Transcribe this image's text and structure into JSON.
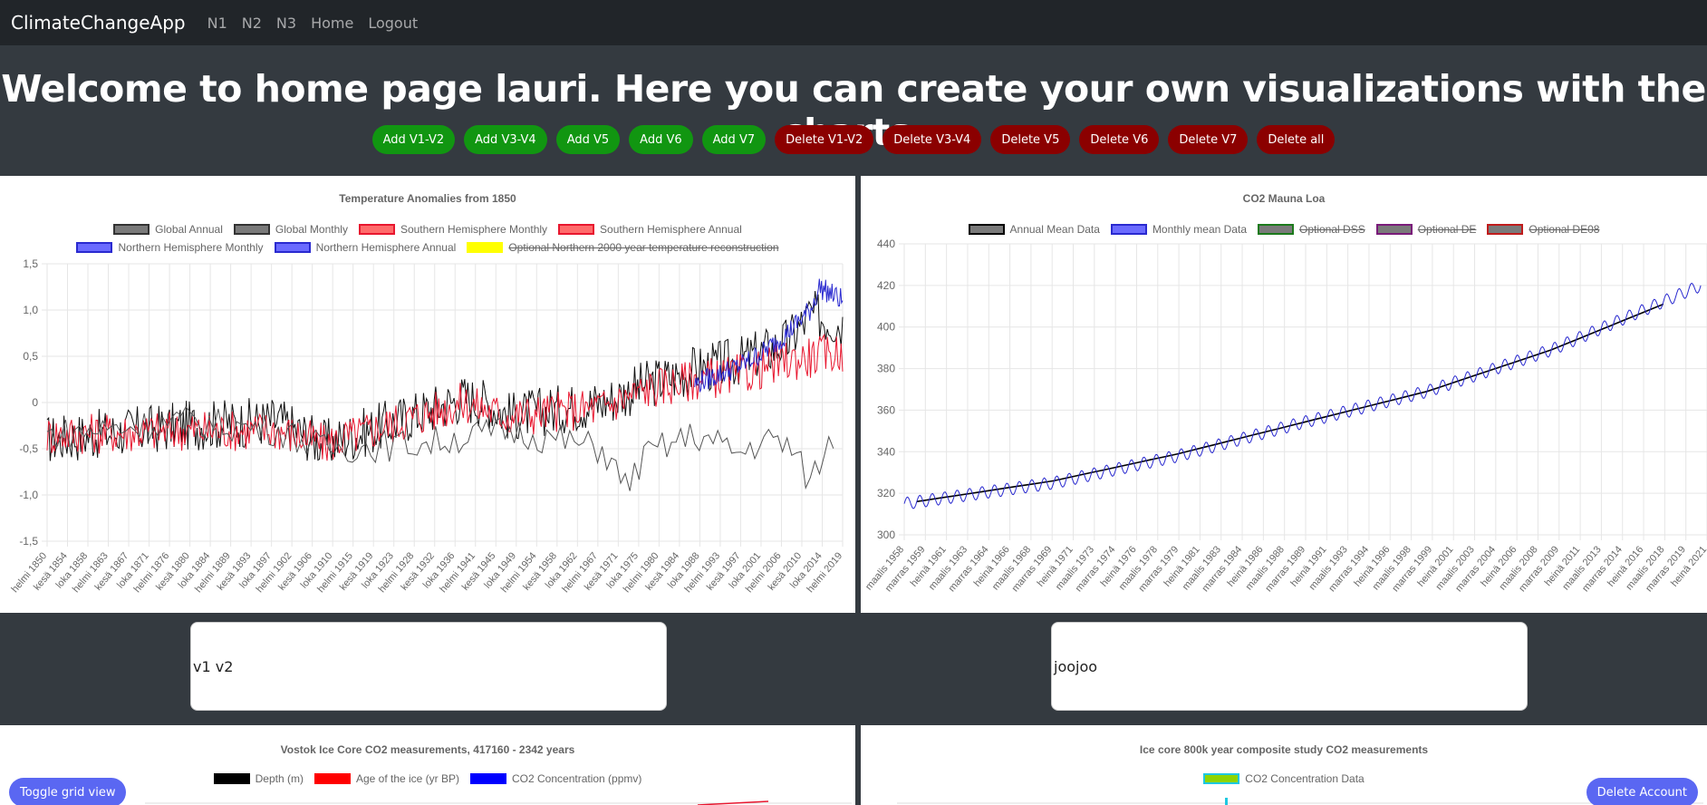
{
  "nav": {
    "brand": "ClimateChangeApp",
    "links": [
      "N1",
      "N2",
      "N3",
      "Home",
      "Logout"
    ]
  },
  "welcome": "Welcome to home page lauri. Here you can create your own visualizations with the charts.",
  "buttons": {
    "add": [
      "Add V1-V2",
      "Add V3-V4",
      "Add V5",
      "Add V6",
      "Add V7"
    ],
    "delete": [
      "Delete V1-V2",
      "Delete V3-V4",
      "Delete V5",
      "Delete V6",
      "Delete V7",
      "Delete all"
    ]
  },
  "colors": {
    "add_button": "#119611",
    "delete_button": "#8b0000",
    "float_button": "#5a67f2"
  },
  "descriptions": [
    "v1 v2",
    "joojoo"
  ],
  "floating": {
    "toggle_grid": "Toggle grid view",
    "delete_account": "Delete Account"
  },
  "chart_data": [
    {
      "type": "line",
      "title": "Temperature Anomalies from 1850",
      "legend": [
        {
          "label": "Global Annual",
          "fill": "#7a7a7a",
          "border": "#333333",
          "hidden": false
        },
        {
          "label": "Global Monthly",
          "fill": "#7a7a7a",
          "border": "#333333",
          "hidden": false
        },
        {
          "label": "Southern Hemisphere Monthly",
          "fill": "#ff6b6b",
          "border": "#e8172f",
          "hidden": false
        },
        {
          "label": "Southern Hemisphere Annual",
          "fill": "#ff6b6b",
          "border": "#e8172f",
          "hidden": false
        },
        {
          "label": "Northern Hemisphere Monthly",
          "fill": "#6b6bff",
          "border": "#2a2ad0",
          "hidden": false
        },
        {
          "label": "Northern Hemisphere Annual",
          "fill": "#6b6bff",
          "border": "#2a2ad0",
          "hidden": false
        },
        {
          "label": "Optional Northern 2000 year temperature reconstruction",
          "fill": "#ffff00",
          "border": "#ffff00",
          "hidden": true
        }
      ],
      "y_ticks": [
        "1,5",
        "1,0",
        "0,5",
        "0",
        "-0,5",
        "-1,0",
        "-1,5"
      ],
      "ylim": [
        -1.5,
        1.5
      ],
      "x_ticks": [
        "helmi 1850",
        "kesä 1854",
        "loka 1858",
        "helmi 1863",
        "kesä 1867",
        "loka 1871",
        "helmi 1876",
        "kesä 1880",
        "loka 1884",
        "helmi 1889",
        "kesä 1893",
        "loka 1897",
        "helmi 1902",
        "kesä 1906",
        "loka 1910",
        "helmi 1915",
        "kesä 1919",
        "loka 1923",
        "helmi 1928",
        "kesä 1932",
        "loka 1936",
        "helmi 1941",
        "kesä 1945",
        "loka 1949",
        "helmi 1954",
        "kesä 1958",
        "loka 1962",
        "helmi 1967",
        "kesä 1971",
        "loka 1975",
        "helmi 1980",
        "kesä 1984",
        "loka 1988",
        "helmi 1993",
        "kesä 1997",
        "loka 2001",
        "helmi 2006",
        "kesä 2010",
        "loka 2014",
        "helmi 2019"
      ],
      "series": [
        {
          "name": "Global Monthly",
          "color": "#111111",
          "x": [
            1850,
            1880,
            1900,
            1910,
            1920,
            1940,
            1945,
            1950,
            1970,
            1980,
            1990,
            2000,
            2010,
            2015,
            2022
          ],
          "y": [
            -0.4,
            -0.25,
            -0.2,
            -0.45,
            -0.3,
            0.05,
            0.0,
            -0.15,
            0.0,
            0.2,
            0.35,
            0.45,
            0.65,
            0.95,
            0.85
          ]
        },
        {
          "name": "Southern Hemisphere Monthly",
          "color": "#e8172f",
          "x": [
            1850,
            1880,
            1900,
            1910,
            1920,
            1940,
            1950,
            1970,
            1980,
            1990,
            2000,
            2010,
            2022
          ],
          "y": [
            -0.35,
            -0.3,
            -0.3,
            -0.45,
            -0.3,
            0.0,
            -0.15,
            -0.05,
            0.15,
            0.25,
            0.3,
            0.45,
            0.55
          ]
        },
        {
          "name": "Northern Hemisphere Monthly",
          "color": "#2a2ad0",
          "x": [
            1990,
            2000,
            2005,
            2010,
            2015,
            2017,
            2022
          ],
          "y": [
            0.2,
            0.4,
            0.55,
            0.75,
            1.0,
            1.25,
            1.1
          ]
        },
        {
          "name": "Global Annual",
          "color": "#555555",
          "x": [
            1850,
            1880,
            1900,
            1910,
            1930,
            1950,
            1970,
            1975,
            1980,
            1990,
            2000,
            2005,
            2010,
            2015,
            2020
          ],
          "y": [
            -0.35,
            -0.2,
            -0.3,
            -0.5,
            -0.45,
            -0.3,
            -0.5,
            -0.9,
            -0.55,
            -0.35,
            -0.55,
            -0.4,
            -0.45,
            -0.85,
            -0.35
          ]
        }
      ]
    },
    {
      "type": "line",
      "title": "CO2 Mauna Loa",
      "legend": [
        {
          "label": "Annual Mean Data",
          "fill": "#7a7a7a",
          "border": "#000000",
          "hidden": false
        },
        {
          "label": "Monthly mean Data",
          "fill": "#6b6bff",
          "border": "#2a2ad0",
          "hidden": false
        },
        {
          "label": "Optional DSS",
          "fill": "#7a7a7a",
          "border": "#1c7a1c",
          "hidden": true
        },
        {
          "label": "Optional DE",
          "fill": "#7a7a7a",
          "border": "#7a1c7a",
          "hidden": true
        },
        {
          "label": "Optional DE08",
          "fill": "#7a7a7a",
          "border": "#c01c1c",
          "hidden": true
        }
      ],
      "y_ticks": [
        "440",
        "420",
        "400",
        "380",
        "360",
        "340",
        "320",
        "300"
      ],
      "ylim": [
        300,
        440
      ],
      "x_ticks": [
        "maalis 1958",
        "marras 1959",
        "heinä 1961",
        "maalis 1963",
        "marras 1964",
        "heinä 1966",
        "maalis 1968",
        "marras 1969",
        "heinä 1971",
        "maalis 1973",
        "marras 1974",
        "heinä 1976",
        "maalis 1978",
        "marras 1979",
        "heinä 1981",
        "maalis 1983",
        "marras 1984",
        "heinä 1986",
        "maalis 1988",
        "marras 1989",
        "heinä 1991",
        "maalis 1993",
        "marras 1994",
        "heinä 1996",
        "maalis 1998",
        "marras 1999",
        "heinä 2001",
        "maalis 2003",
        "marras 2004",
        "heinä 2006",
        "maalis 2008",
        "marras 2009",
        "heinä 2011",
        "maalis 2013",
        "marras 2014",
        "heinä 2016",
        "maalis 2018",
        "marras 2019",
        "heinä 2021"
      ],
      "series": [
        {
          "name": "Annual Mean Data",
          "color": "#000000",
          "x": [
            1959,
            1970,
            1980,
            1990,
            2000,
            2010,
            2019
          ],
          "y": [
            316,
            326,
            339,
            354,
            369,
            389,
            411
          ]
        },
        {
          "name": "Monthly mean Data",
          "color": "#2a2ad0",
          "x": [
            1958,
            1970,
            1980,
            1990,
            2000,
            2010,
            2022
          ],
          "y": [
            315,
            325,
            338,
            354,
            369,
            389,
            420
          ]
        }
      ]
    },
    {
      "type": "line",
      "title": "Vostok Ice Core CO2 measurements, 417160 - 2342 years",
      "legend": [
        {
          "label": "Depth (m)",
          "fill": "#000000",
          "border": "#000000",
          "hidden": false
        },
        {
          "label": "Age of the ice (yr BP)",
          "fill": "#ff0000",
          "border": "#ff0000",
          "hidden": false
        },
        {
          "label": "CO2 Concentration (ppmv)",
          "fill": "#0000ff",
          "border": "#0000ff",
          "hidden": false
        }
      ]
    },
    {
      "type": "line",
      "title": "Ice core 800k year composite study CO2 measurements",
      "legend": [
        {
          "label": "CO2 Concentration Data",
          "fill": "#8fd400",
          "border": "#1ec8e0",
          "hidden": false
        }
      ]
    }
  ]
}
